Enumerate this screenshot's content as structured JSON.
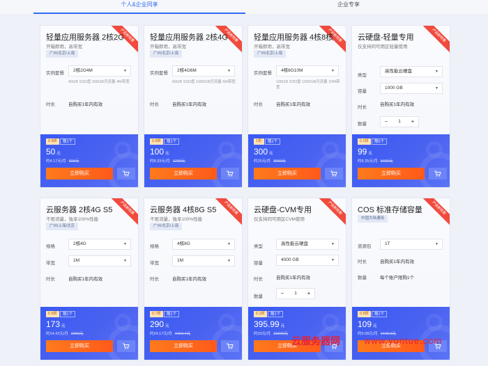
{
  "tabs": [
    {
      "label": "个人&企业同享",
      "active": true
    },
    {
      "label": "企业专享",
      "active": false
    }
  ],
  "accent_color": "#2f6bf4",
  "buy_color": "#ff6a1a",
  "cards": [
    {
      "title": "轻量应用服务器 2核2G",
      "subtitle": "开箱即用，高带宽",
      "region": "广州/北京/上海",
      "ribbon": "产品新特惠",
      "spec_label": "实例套餐",
      "spec_value": "2核2G4M",
      "spec_desc": "40GB SSD盘 300GB月流量 4M带宽",
      "duration_label": "时长",
      "duration_value": "自购买1年内有效",
      "discount": "0.8折",
      "limit": "限1个",
      "price": "50",
      "unit": "元",
      "monthly": "约4.17元/月",
      "original": "600元",
      "buy_label": "立即购买"
    },
    {
      "title": "轻量应用服务器 2核4G",
      "subtitle": "开箱即用，高带宽",
      "region": "广州/北京/上海",
      "ribbon": "产品新特惠",
      "spec_label": "实例套餐",
      "spec_value": "2核4G6M",
      "spec_desc": "60GB SSD盘 1000GB月流量 6M带宽",
      "duration_label": "时长",
      "duration_value": "自购买1年内有效",
      "discount": "0.8折",
      "limit": "限1个",
      "price": "100",
      "unit": "元",
      "monthly": "约8.33元/月",
      "original": "1200元",
      "buy_label": "立即购买"
    },
    {
      "title": "轻量应用服务器 4核8核",
      "subtitle": "开箱即用，高带宽",
      "region": "广州/北京/上海",
      "ribbon": "产品新特惠",
      "spec_label": "实例套餐",
      "spec_value": "4核8G10M",
      "spec_desc": "100GB SSD盘 1500GB月流量 10M带宽",
      "duration_label": "时长",
      "duration_value": "自购买1年内有效",
      "discount": "1折",
      "limit": "限1个",
      "price": "300",
      "unit": "元",
      "monthly": "约25元/月",
      "original": "3060元",
      "buy_label": "立即购买"
    },
    {
      "title": "云硬盘-轻量专用",
      "subtitle": "仅支持同可用区轻量使用",
      "ribbon": "产品新特惠",
      "type_label": "类型",
      "type_value": "高性能云硬盘",
      "capacity_label": "容量",
      "capacity_value": "1000 GB",
      "duration_label": "时长",
      "duration_value": "自购买1年内有效",
      "qty_label": "数量",
      "qty_value": "1",
      "discount": "0.2折",
      "limit": "限5个",
      "price": "99",
      "unit": "元",
      "monthly": "约8.25元/月",
      "original": "5400元",
      "buy_label": "立即购买"
    },
    {
      "title": "云服务器 2核4G S5",
      "subtitle": "不限流量，独享100%性能",
      "region": "广州/上海/北京",
      "ribbon": "产品新特惠",
      "spec_label": "规格",
      "spec_value": "2核4G",
      "bw_label": "带宽",
      "bw_value": "1M",
      "duration_label": "时长",
      "duration_value": "自购买1年内有效",
      "discount": "0.8折",
      "limit": "限1个",
      "price": "173",
      "unit": "元",
      "monthly": "约14.42元/月",
      "original": "2266元",
      "buy_label": "立即购买"
    },
    {
      "title": "云服务器 4核8G S5",
      "subtitle": "不限流量，独享100%性能",
      "region": "广州/北京/上海",
      "ribbon": "产品新特惠",
      "spec_label": "规格",
      "spec_value": "4核8G",
      "bw_label": "带宽",
      "bw_value": "1M",
      "duration_label": "时长",
      "duration_value": "自购买1年内有效",
      "discount": "0.7折",
      "limit": "限1个",
      "price": "290",
      "unit": "元",
      "monthly": "约24.17元/月",
      "original": "4424.4元",
      "buy_label": "立即购买"
    },
    {
      "title": "云硬盘-CVM专用",
      "subtitle": "仅支持同可用区CVM使用",
      "ribbon": "产品新特惠",
      "type_label": "类型",
      "type_value": "高性能云硬盘",
      "capacity_label": "容量",
      "capacity_value": "4000 GB",
      "duration_label": "时长",
      "duration_value": "自购买1年内有效",
      "qty_label": "数量",
      "qty_value": "1",
      "discount": "0.2折",
      "limit": "限1个",
      "price": "395.99",
      "unit": "元",
      "monthly": "约33元/月",
      "original": "21600元",
      "buy_label": "立即购买"
    },
    {
      "title": "COS 标准存储容量",
      "region": "中国大陆通用",
      "ribbon": "产品新特惠",
      "pack_label": "资源包",
      "pack_value": "1T",
      "duration_label": "时长",
      "duration_value": "自购买1年内有效",
      "qty_label": "数量",
      "qty_value": "每个账户限购1个",
      "discount": "0.8折",
      "limit": "限1个",
      "price": "109",
      "unit": "元",
      "monthly": "约9.08元/月",
      "original": "1440.0元",
      "buy_label": "立即购买"
    }
  ],
  "watermark": "云服务器网",
  "watermark_url": "www.yuntue.com"
}
